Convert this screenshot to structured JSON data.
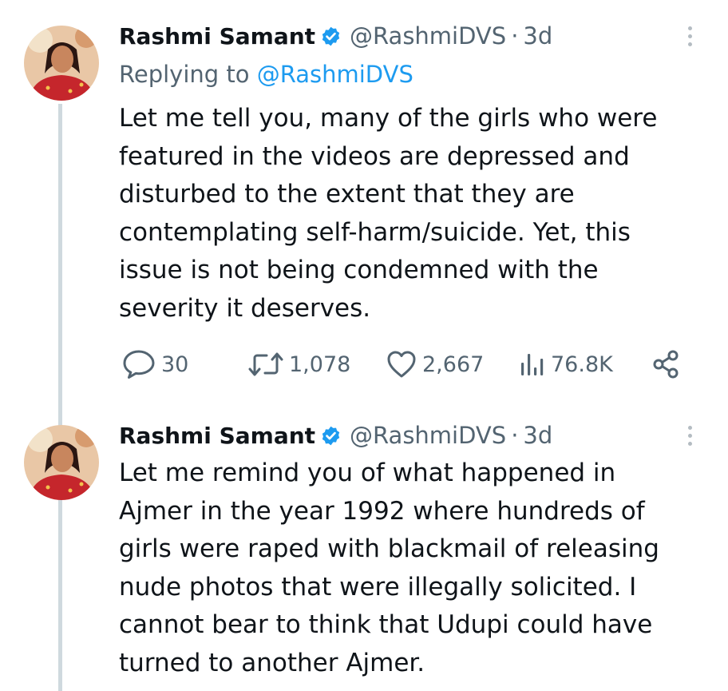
{
  "tweets": [
    {
      "author_name": "Rashmi Samant",
      "handle": "@RashmiDVS",
      "separator": "·",
      "time": "3d",
      "replying_prefix": "Replying to ",
      "replying_to": "@RashmiDVS",
      "text": "Let me tell you, many of the girls who were\nfeatured in the videos are depressed and\ndisturbed to the extent that they are\ncontemplating self-harm/suicide. Yet, this\nissue is not being condemned with the\nseverity it deserves.",
      "stats": {
        "replies": "30",
        "retweets": "1,078",
        "likes": "2,667",
        "views": "76.8K"
      }
    },
    {
      "author_name": "Rashmi Samant",
      "handle": "@RashmiDVS",
      "separator": "·",
      "time": "3d",
      "text": "Let me remind you of what happened in\nAjmer in the year 1992 where hundreds of\ngirls were raped with blackmail of releasing\nnude photos that were illegally solicited. I\ncannot bear to think that Udupi could have\nturned to another Ajmer."
    }
  ],
  "icons": {
    "verified": "verified-badge-icon",
    "more": "more-vertical-icon",
    "reply": "reply-icon",
    "retweet": "retweet-icon",
    "like": "heart-icon",
    "views": "views-chart-icon",
    "share": "share-icon"
  },
  "colors": {
    "text": "#0f1419",
    "secondary": "#536471",
    "link": "#1d9bf0",
    "verified": "#1d9bf0",
    "thread_line": "#cfd9de"
  }
}
